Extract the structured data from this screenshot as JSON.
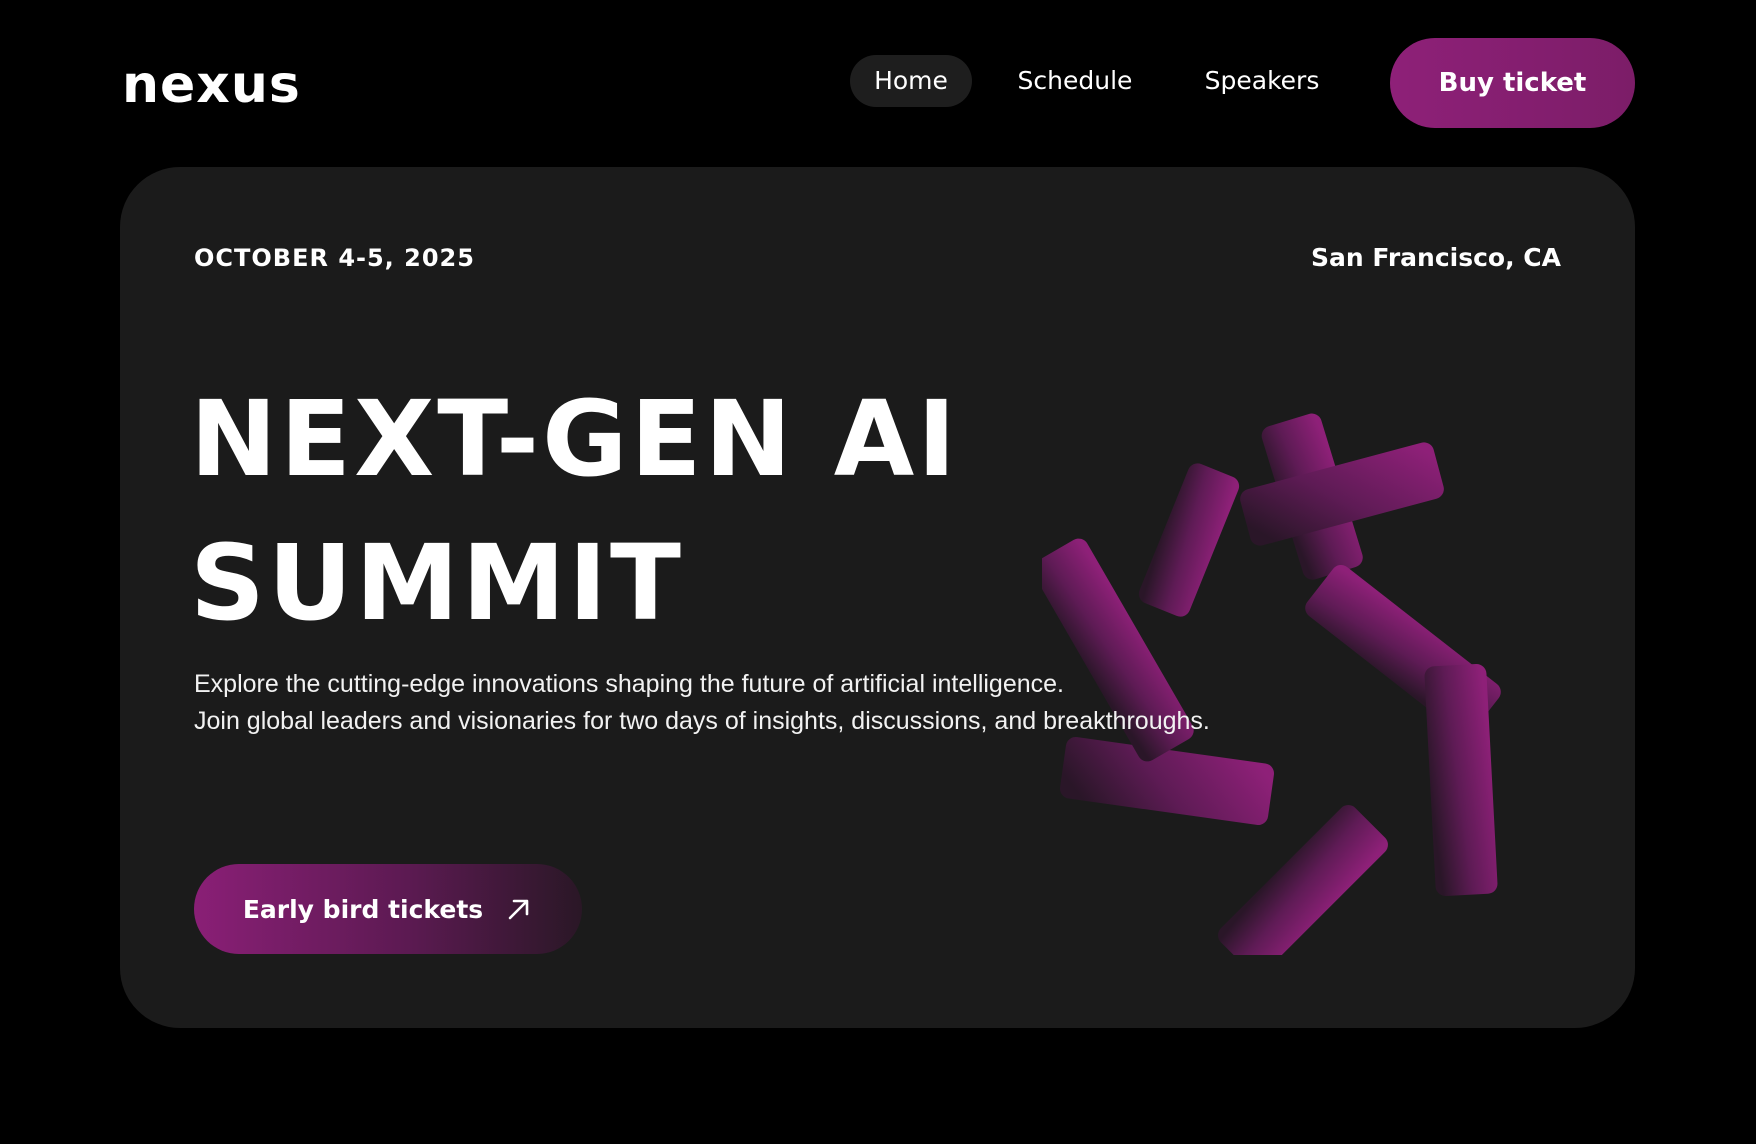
{
  "header": {
    "logo": "nexus",
    "nav": [
      {
        "label": "Home",
        "active": true
      },
      {
        "label": "Schedule",
        "active": false
      },
      {
        "label": "Speakers",
        "active": false
      }
    ],
    "cta_label": "Buy ticket"
  },
  "hero": {
    "date": "OCTOBER 4-5, 2025",
    "location": "San Francisco, CA",
    "title_line1": "NEXT-GEN AI",
    "title_line2": "SUMMIT",
    "description_line1": "Explore the cutting-edge innovations shaping the future of artificial intelligence.",
    "description_line2": "Join global leaders and visionaries for two days of insights, discussions, and breakthroughs.",
    "cta_label": "Early bird tickets",
    "cta_icon": "arrow-up-right-icon",
    "graphic_icon": "abstract-gear-shape"
  },
  "colors": {
    "background": "#000000",
    "card": "#1b1b1b",
    "accent": "#8e2078",
    "nav_active_bg": "#1e1e1e",
    "text": "#ffffff"
  }
}
